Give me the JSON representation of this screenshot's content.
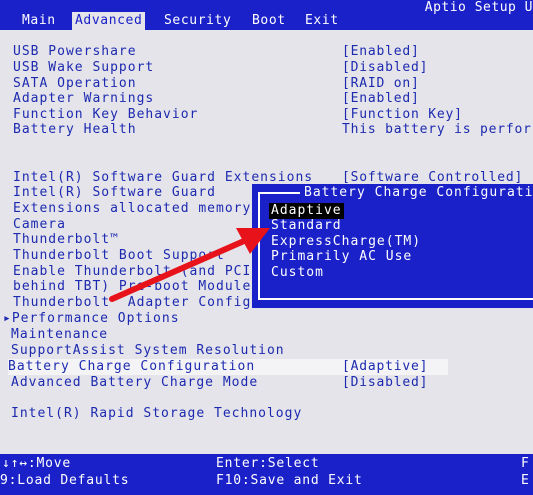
{
  "header": {
    "title": "Aptio Setup U",
    "tabs": [
      {
        "label": "Main"
      },
      {
        "label": "Advanced"
      },
      {
        "label": "Security"
      },
      {
        "label": "Boot"
      },
      {
        "label": "Exit"
      }
    ],
    "active_tab": "Advanced"
  },
  "settings": [
    {
      "label": "USB Powershare",
      "value": "[Enabled]"
    },
    {
      "label": "USB Wake Support",
      "value": "[Disabled]"
    },
    {
      "label": "SATA Operation",
      "value": "[RAID on]"
    },
    {
      "label": "Adapter Warnings",
      "value": "[Enabled]"
    },
    {
      "label": "Function Key Behavior",
      "value": "[Function Key]"
    },
    {
      "label": "Battery Health",
      "value": "This battery is perfor"
    },
    {
      "label": "Intel(R) Software Guard Extensions",
      "value": "[Software Controlled]"
    },
    {
      "label": "Intel(R) Software Guard"
    },
    {
      "label": "Extensions allocated memory"
    },
    {
      "label": "Camera"
    },
    {
      "label": "Thunderbolt™"
    },
    {
      "label": "Thunderbolt Boot Support"
    },
    {
      "label": "Enable Thunderbolt (and PCI"
    },
    {
      "label": "behind TBT) Pre-boot Module"
    },
    {
      "label": "Thunderbolt™ Adapter Configur"
    },
    {
      "label": "▸Performance Options"
    },
    {
      "label": "Maintenance"
    },
    {
      "label": "SupportAssist System Resolution"
    },
    {
      "label": "Battery Charge Configuration",
      "value": "[Adaptive]"
    },
    {
      "label": "Advanced Battery Charge Mode",
      "value": "[Disabled]"
    },
    {
      "label": "Intel(R) Rapid Storage Technology"
    }
  ],
  "popup": {
    "title": "Battery Charge Configuratio",
    "options": [
      "Adaptive",
      "Standard",
      "ExpressCharge(TM)",
      "Primarily AC Use",
      "Custom"
    ],
    "selected": "Adaptive"
  },
  "footer": {
    "move": "↓↑↔:Move",
    "load_defaults": "9:Load Defaults",
    "select": "Enter:Select",
    "save_exit": "F10:Save and Exit",
    "right1": "F",
    "right2": "E"
  },
  "colors": {
    "bios_blue": "#1a21c8",
    "background": "#e4e4ea",
    "arrow": "#e8121a"
  }
}
